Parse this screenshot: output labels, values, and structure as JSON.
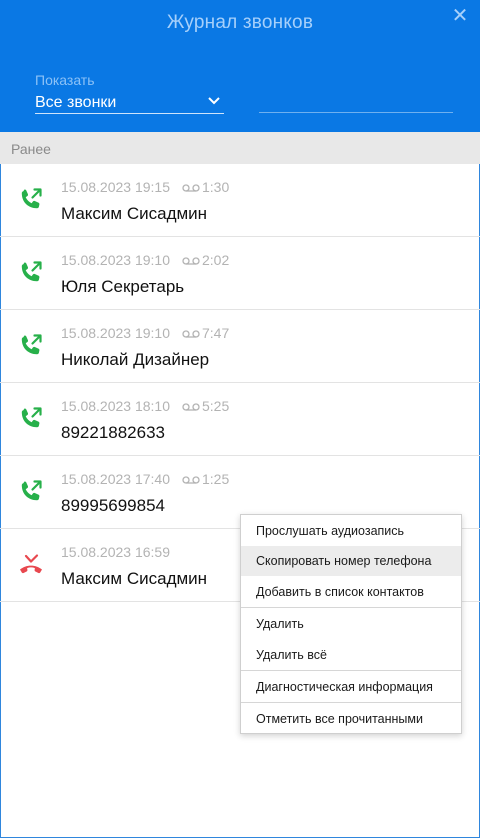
{
  "header": {
    "title": "Журнал звонков",
    "close_glyph": "✕",
    "filter_label": "Показать",
    "filter_value": "Все звонки",
    "accent": "#0a78e4"
  },
  "section": {
    "label": "Ранее"
  },
  "calls": [
    {
      "datetime": "15.08.2023 19:15",
      "duration": "1:30",
      "name": "Максим Сисадмин",
      "type": "outgoing",
      "icon": "outgoing-call-icon",
      "color": "#27b04a"
    },
    {
      "datetime": "15.08.2023 19:10",
      "duration": "2:02",
      "name": "Юля Секретарь",
      "type": "outgoing",
      "icon": "outgoing-call-icon",
      "color": "#27b04a"
    },
    {
      "datetime": "15.08.2023 19:10",
      "duration": "7:47",
      "name": "Николай Дизайнер",
      "type": "outgoing",
      "icon": "outgoing-call-icon",
      "color": "#27b04a"
    },
    {
      "datetime": "15.08.2023 18:10",
      "duration": "5:25",
      "name": "89221882633",
      "type": "outgoing",
      "icon": "outgoing-call-icon",
      "color": "#27b04a"
    },
    {
      "datetime": "15.08.2023 17:40",
      "duration": "1:25",
      "name": "89995699854",
      "type": "outgoing",
      "icon": "outgoing-call-icon",
      "color": "#27b04a"
    },
    {
      "datetime": "15.08.2023 16:59",
      "duration": "",
      "name": "Максим Сисадмин",
      "type": "missed",
      "icon": "missed-call-icon",
      "color": "#e8484f"
    }
  ],
  "context_menu": {
    "items": [
      "Прослушать аудиозапись",
      "Скопировать номер телефона",
      "Добавить в список контактов",
      "Удалить",
      "Удалить всё",
      "Диагностическая информация",
      "Отметить все прочитанными"
    ],
    "highlighted": "Скопировать номер телефона"
  }
}
